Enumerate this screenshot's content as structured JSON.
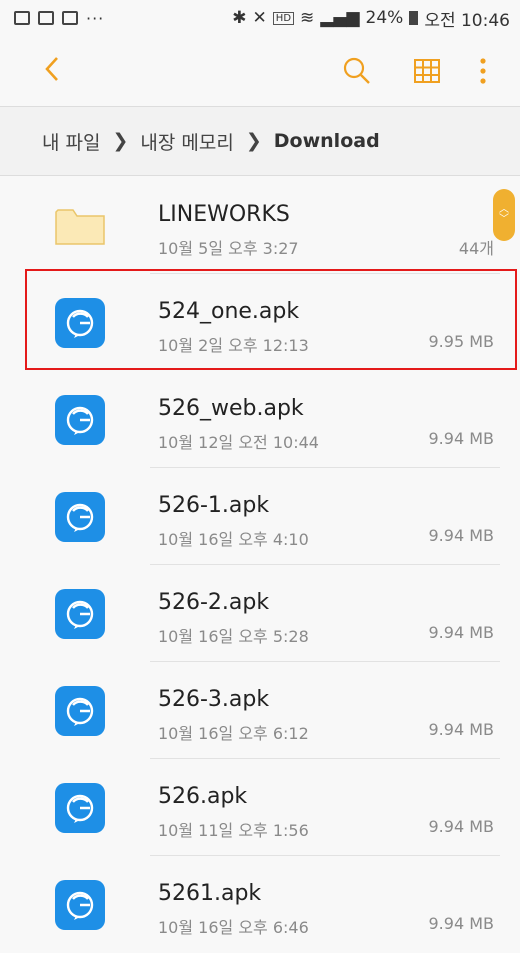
{
  "status_bar": {
    "battery": "24%",
    "time": "오전 10:46"
  },
  "app_bar": {
    "back_icon": "chevron-left-icon",
    "search_icon": "search-icon",
    "grid_icon": "grid-view-icon",
    "more_icon": "more-vert-icon",
    "accent": "#f0a020"
  },
  "breadcrumb": {
    "items": [
      "내 파일",
      "내장 메모리",
      "Download"
    ]
  },
  "files": [
    {
      "name": "LINEWORKS",
      "date": "10월 5일 오후 3:27",
      "size": "44개",
      "type": "folder"
    },
    {
      "name": "524_one.apk",
      "date": "10월 2일 오후 12:13",
      "size": "9.95 MB",
      "type": "apk",
      "highlighted": true
    },
    {
      "name": "526_web.apk",
      "date": "10월 12일 오전 10:44",
      "size": "9.94 MB",
      "type": "apk"
    },
    {
      "name": "526-1.apk",
      "date": "10월 16일 오후 4:10",
      "size": "9.94 MB",
      "type": "apk"
    },
    {
      "name": "526-2.apk",
      "date": "10월 16일 오후 5:28",
      "size": "9.94 MB",
      "type": "apk"
    },
    {
      "name": "526-3.apk",
      "date": "10월 16일 오후 6:12",
      "size": "9.94 MB",
      "type": "apk"
    },
    {
      "name": "526.apk",
      "date": "10월 11일 오후 1:56",
      "size": "9.94 MB",
      "type": "apk"
    },
    {
      "name": "5261.apk",
      "date": "10월 16일 오후 6:46",
      "size": "9.94 MB",
      "type": "apk"
    }
  ],
  "colors": {
    "apk_icon": "#1e8fe6",
    "folder": "#f7d88a",
    "highlight": "#e41a1a"
  }
}
